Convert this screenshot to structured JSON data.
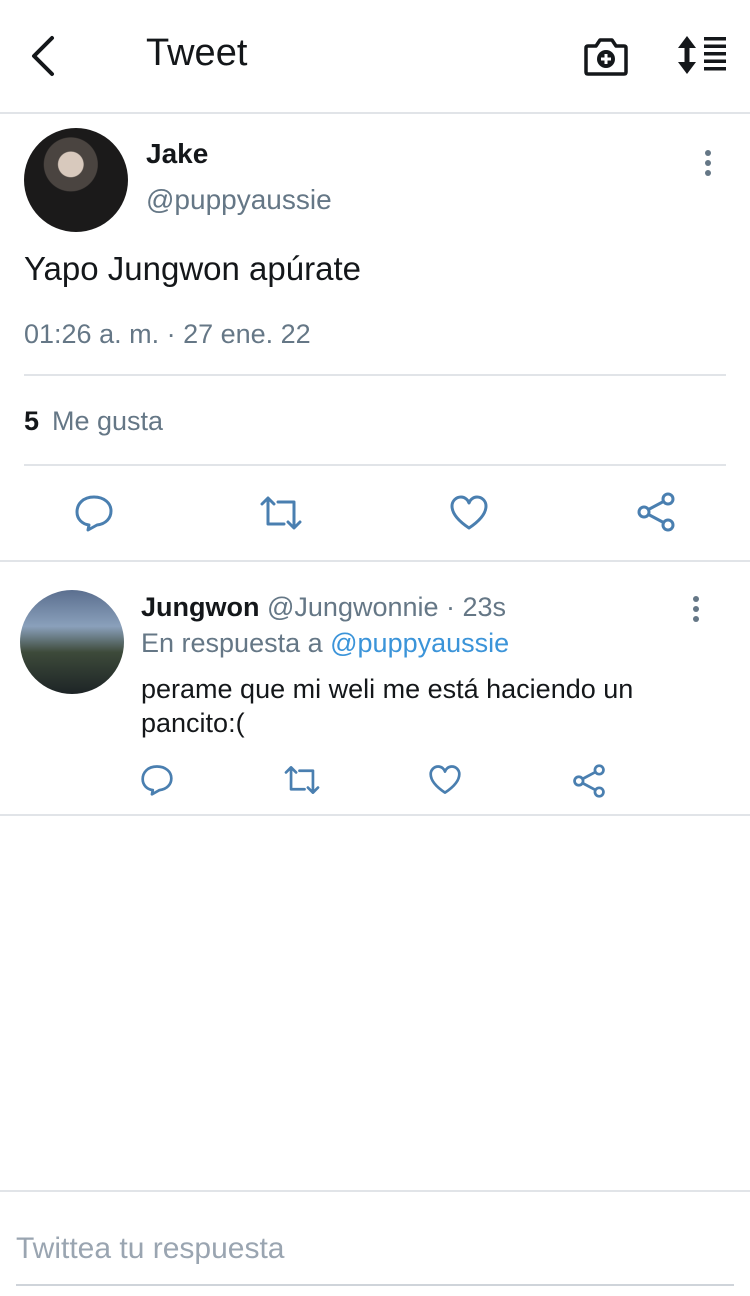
{
  "header": {
    "title": "Tweet",
    "icons": {
      "back": "chevron-left-icon",
      "camera": "camera-add-icon",
      "sort": "sort-list-icon"
    }
  },
  "main_tweet": {
    "author_name": "Jake",
    "author_handle": "@puppyaussie",
    "text": "Yapo Jungwon apúrate",
    "timestamp": "01:26 a. m. · 27 ene. 22",
    "likes_count": "5",
    "likes_label": "Me gusta",
    "actions": [
      "reply-icon",
      "retweet-icon",
      "like-icon",
      "share-icon"
    ]
  },
  "reply_tweet": {
    "author_name": "Jungwon",
    "author_handle": "@Jungwonnie",
    "time_ago": " · 23s",
    "in_reply_prefix": "En respuesta a ",
    "in_reply_handle": "@puppyaussie",
    "text": "perame que mi weli me está haciendo un pancito:(",
    "actions": [
      "reply-icon",
      "retweet-icon",
      "like-icon",
      "share-icon"
    ]
  },
  "compose": {
    "placeholder": "Twittea tu respuesta"
  },
  "colors": {
    "text": "#14171a",
    "secondary": "#657786",
    "link": "#3b94d9",
    "divider": "#e1e4e8"
  }
}
